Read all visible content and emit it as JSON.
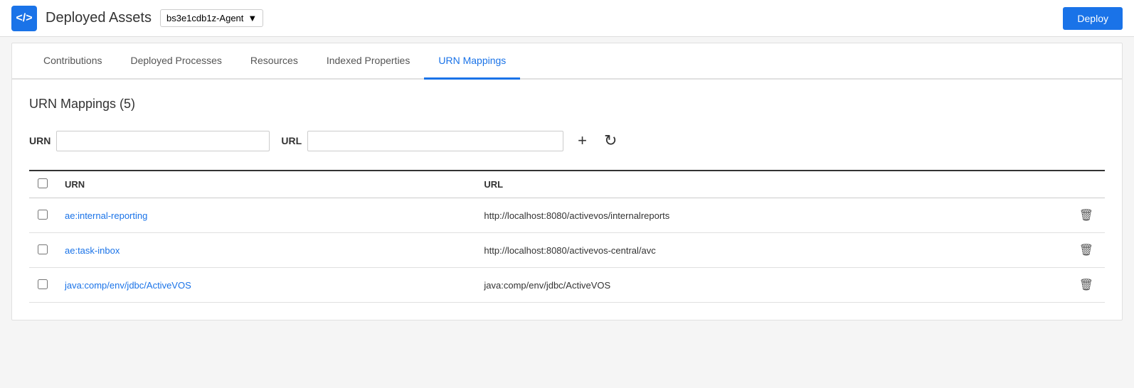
{
  "header": {
    "app_icon": "</>",
    "title": "Deployed Assets",
    "agent_dropdown": "bs3e1cdb1z-Agent",
    "deploy_button": "Deploy"
  },
  "tabs": [
    {
      "id": "contributions",
      "label": "Contributions",
      "active": false
    },
    {
      "id": "deployed-processes",
      "label": "Deployed Processes",
      "active": false
    },
    {
      "id": "resources",
      "label": "Resources",
      "active": false
    },
    {
      "id": "indexed-properties",
      "label": "Indexed Properties",
      "active": false
    },
    {
      "id": "urn-mappings",
      "label": "URN Mappings",
      "active": true
    }
  ],
  "content": {
    "section_title": "URN Mappings (5)",
    "urn_label": "URN",
    "url_label": "URL",
    "urn_placeholder": "",
    "url_placeholder": "",
    "table": {
      "columns": [
        "",
        "URN",
        "URL",
        ""
      ],
      "rows": [
        {
          "urn": "ae:internal-reporting",
          "url": "http://localhost:8080/activevos/internalreports"
        },
        {
          "urn": "ae:task-inbox",
          "url": "http://localhost:8080/activevos-central/avc"
        },
        {
          "urn": "java:comp/env/jdbc/ActiveVOS",
          "url": "java:comp/env/jdbc/ActiveVOS"
        }
      ]
    }
  }
}
